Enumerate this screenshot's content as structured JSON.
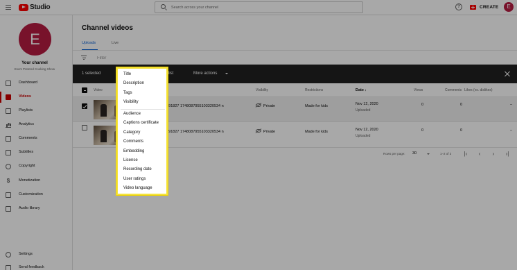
{
  "app": {
    "logo_text": "Studio",
    "search_placeholder": "Search across your channel",
    "create_label": "CREATE",
    "help_glyph": "?",
    "avatar_letter": "E"
  },
  "sidebar": {
    "avatar_letter": "E",
    "channel_title": "Your channel",
    "channel_name": "Eva's Pretend Cooking Show",
    "items": [
      {
        "label": "Dashboard",
        "icon": "dashboard-icon"
      },
      {
        "label": "Videos",
        "icon": "videos-icon",
        "active": true
      },
      {
        "label": "Playlists",
        "icon": "playlists-icon"
      },
      {
        "label": "Analytics",
        "icon": "analytics-icon"
      },
      {
        "label": "Comments",
        "icon": "comments-icon"
      },
      {
        "label": "Subtitles",
        "icon": "subtitles-icon"
      },
      {
        "label": "Copyright",
        "icon": "copyright-icon"
      },
      {
        "label": "Monetization",
        "icon": "monetization-icon"
      },
      {
        "label": "Customization",
        "icon": "customization-icon"
      },
      {
        "label": "Audio library",
        "icon": "audio-library-icon"
      }
    ],
    "bottom_items": [
      {
        "label": "Settings",
        "icon": "settings-icon"
      },
      {
        "label": "Send feedback",
        "icon": "feedback-icon"
      }
    ]
  },
  "main": {
    "title": "Channel videos",
    "tabs": [
      {
        "label": "Uploads"
      },
      {
        "label": "Live"
      }
    ],
    "filter_placeholder": "Filter",
    "actionbar": {
      "selected_count": "1 selected",
      "playlist_fragment": "list",
      "more_actions": "More actions"
    },
    "table": {
      "headers": {
        "video": "Video",
        "visibility": "Visibility",
        "restrictions": "Restrictions",
        "date": "Date",
        "views": "Views",
        "comments": "Comments",
        "likes": "Likes (vs. dislikes)"
      },
      "rows": [
        {
          "title_fragment": "77891827 1748087955103320534 n",
          "visibility": "Private",
          "restrictions": "Made for kids",
          "date": "Nov 12, 2020",
          "date_sub": "Uploaded",
          "views": "0",
          "comments": "0",
          "likes": "–",
          "selected": true
        },
        {
          "title_fragment": "77891827 1748087955103320534 n",
          "visibility": "Private",
          "restrictions": "Made for kids",
          "date": "Nov 12, 2020",
          "date_sub": "Uploaded",
          "views": "0",
          "comments": "0",
          "likes": "–",
          "selected": false
        }
      ]
    },
    "pagination": {
      "rows_per_page_label": "Rows per page:",
      "rows_per_page": "30",
      "range": "1–2 of 2"
    }
  },
  "dropdown": {
    "group1": [
      "Title",
      "Description",
      "Tags",
      "Visibility"
    ],
    "group2": [
      "Audience",
      "Captions certificate",
      "Category",
      "Comments",
      "Embedding",
      "License",
      "Recording date",
      "User ratings",
      "Video language"
    ],
    "highlight_color": "#f5e33a"
  }
}
